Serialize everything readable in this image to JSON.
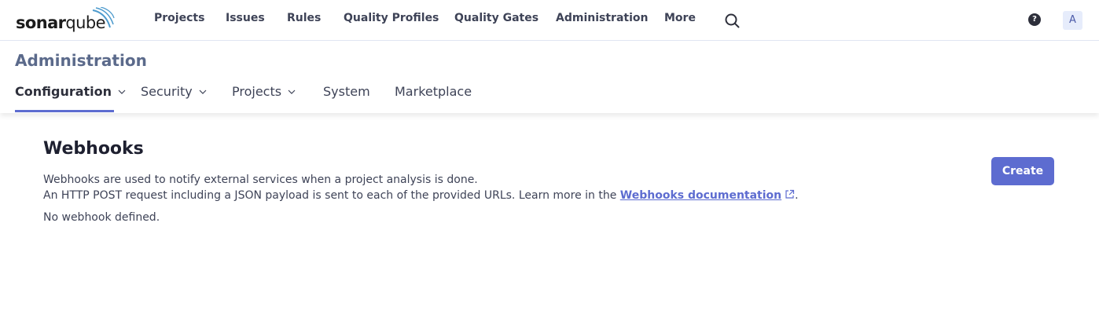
{
  "logo": {
    "text_bold": "sonar",
    "text_light": "qube"
  },
  "nav": {
    "items": [
      "Projects",
      "Issues",
      "Rules",
      "Quality Profiles",
      "Quality Gates",
      "Administration",
      "More"
    ]
  },
  "header_actions": {
    "help_label": "?",
    "avatar_initial": "A"
  },
  "admin": {
    "title": "Administration",
    "tabs": [
      {
        "label": "Configuration",
        "dropdown": true,
        "active": true
      },
      {
        "label": "Security",
        "dropdown": true
      },
      {
        "label": "Projects",
        "dropdown": true
      },
      {
        "label": "System",
        "dropdown": false
      },
      {
        "label": "Marketplace",
        "dropdown": false
      }
    ]
  },
  "webhooks": {
    "title": "Webhooks",
    "description_line1": "Webhooks are used to notify external services when a project analysis is done.",
    "description_line2_prefix": "An HTTP POST request including a JSON payload is sent to each of the provided URLs. Learn more in the ",
    "doc_link_label": "Webhooks documentation",
    "description_line2_suffix": ".",
    "empty_message": "No webhook defined.",
    "create_label": "Create"
  },
  "colors": {
    "accent": "#5d6cd0",
    "admin_title": "#5b6a8b",
    "text": "#3e4357"
  }
}
